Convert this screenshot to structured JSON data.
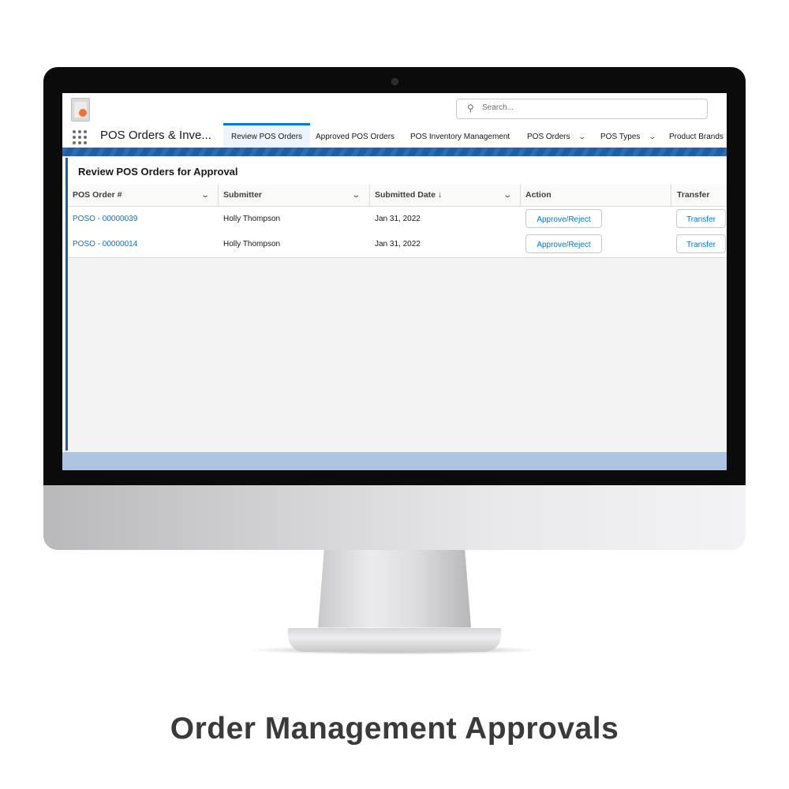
{
  "app": {
    "name": "POS Orders & Inve...",
    "search_placeholder": "Search..."
  },
  "nav": {
    "tabs": [
      {
        "label": "Review POS Orders",
        "active": true
      },
      {
        "label": "Approved POS Orders"
      },
      {
        "label": "POS Inventory Management"
      },
      {
        "label": "POS Orders"
      },
      {
        "label": "POS Types"
      },
      {
        "label": "Product Brands"
      }
    ]
  },
  "card": {
    "title": "Review POS Orders for Approval",
    "columns": [
      "POS Order #",
      "Submitter",
      "Submitted Date ↓",
      "Action",
      "Transfer"
    ],
    "rows": [
      {
        "order": "POSO - 00000039",
        "submitter": "Holly Thompson",
        "date": "Jan 31, 2022",
        "action": "Approve/Reject",
        "transfer": "Transfer"
      },
      {
        "order": "POSO - 00000014",
        "submitter": "Holly Thompson",
        "date": "Jan 31, 2022",
        "action": "Approve/Reject",
        "transfer": "Transfer"
      }
    ]
  },
  "caption": "Order Management Approvals",
  "colors": {
    "accent": "#0176d3",
    "stripe": "#1b5fa8",
    "footer": "#adc4e3"
  },
  "icons": [
    "app-logo-icon",
    "search-icon",
    "app-launcher-icon",
    "chevron-down-icon"
  ]
}
